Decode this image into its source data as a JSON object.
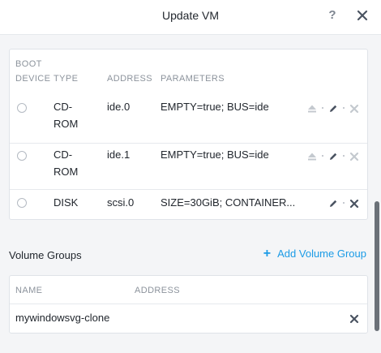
{
  "header": {
    "title": "Update VM",
    "help_label": "?"
  },
  "disks": {
    "columns": [
      "BOOT\nDEVICE",
      "TYPE",
      "ADDRESS",
      "PARAMETERS"
    ],
    "rows": [
      {
        "type": "CD-\nROM",
        "address": "ide.0",
        "parameters": "EMPTY=true; BUS=ide",
        "actions": [
          "eject-icon",
          "edit-icon",
          "delete-icon"
        ]
      },
      {
        "type": "CD-\nROM",
        "address": "ide.1",
        "parameters": "EMPTY=true; BUS=ide",
        "actions": [
          "eject-icon",
          "edit-icon",
          "delete-icon"
        ]
      },
      {
        "type": "DISK",
        "address": "scsi.0",
        "parameters": "SIZE=30GiB; CONTAINER...",
        "actions": [
          "edit-icon",
          "delete-icon"
        ]
      }
    ]
  },
  "volume_groups": {
    "title": "Volume Groups",
    "add_label": "Add Volume Group",
    "columns": [
      "NAME",
      "ADDRESS"
    ],
    "rows": [
      {
        "name": "mywindowsvg-clone",
        "address": ""
      }
    ]
  },
  "colors": {
    "accent": "#1b9be6",
    "close": "#4a5361",
    "muted_icon": "#c4c9cf",
    "scrollbar": "#6b7178"
  }
}
